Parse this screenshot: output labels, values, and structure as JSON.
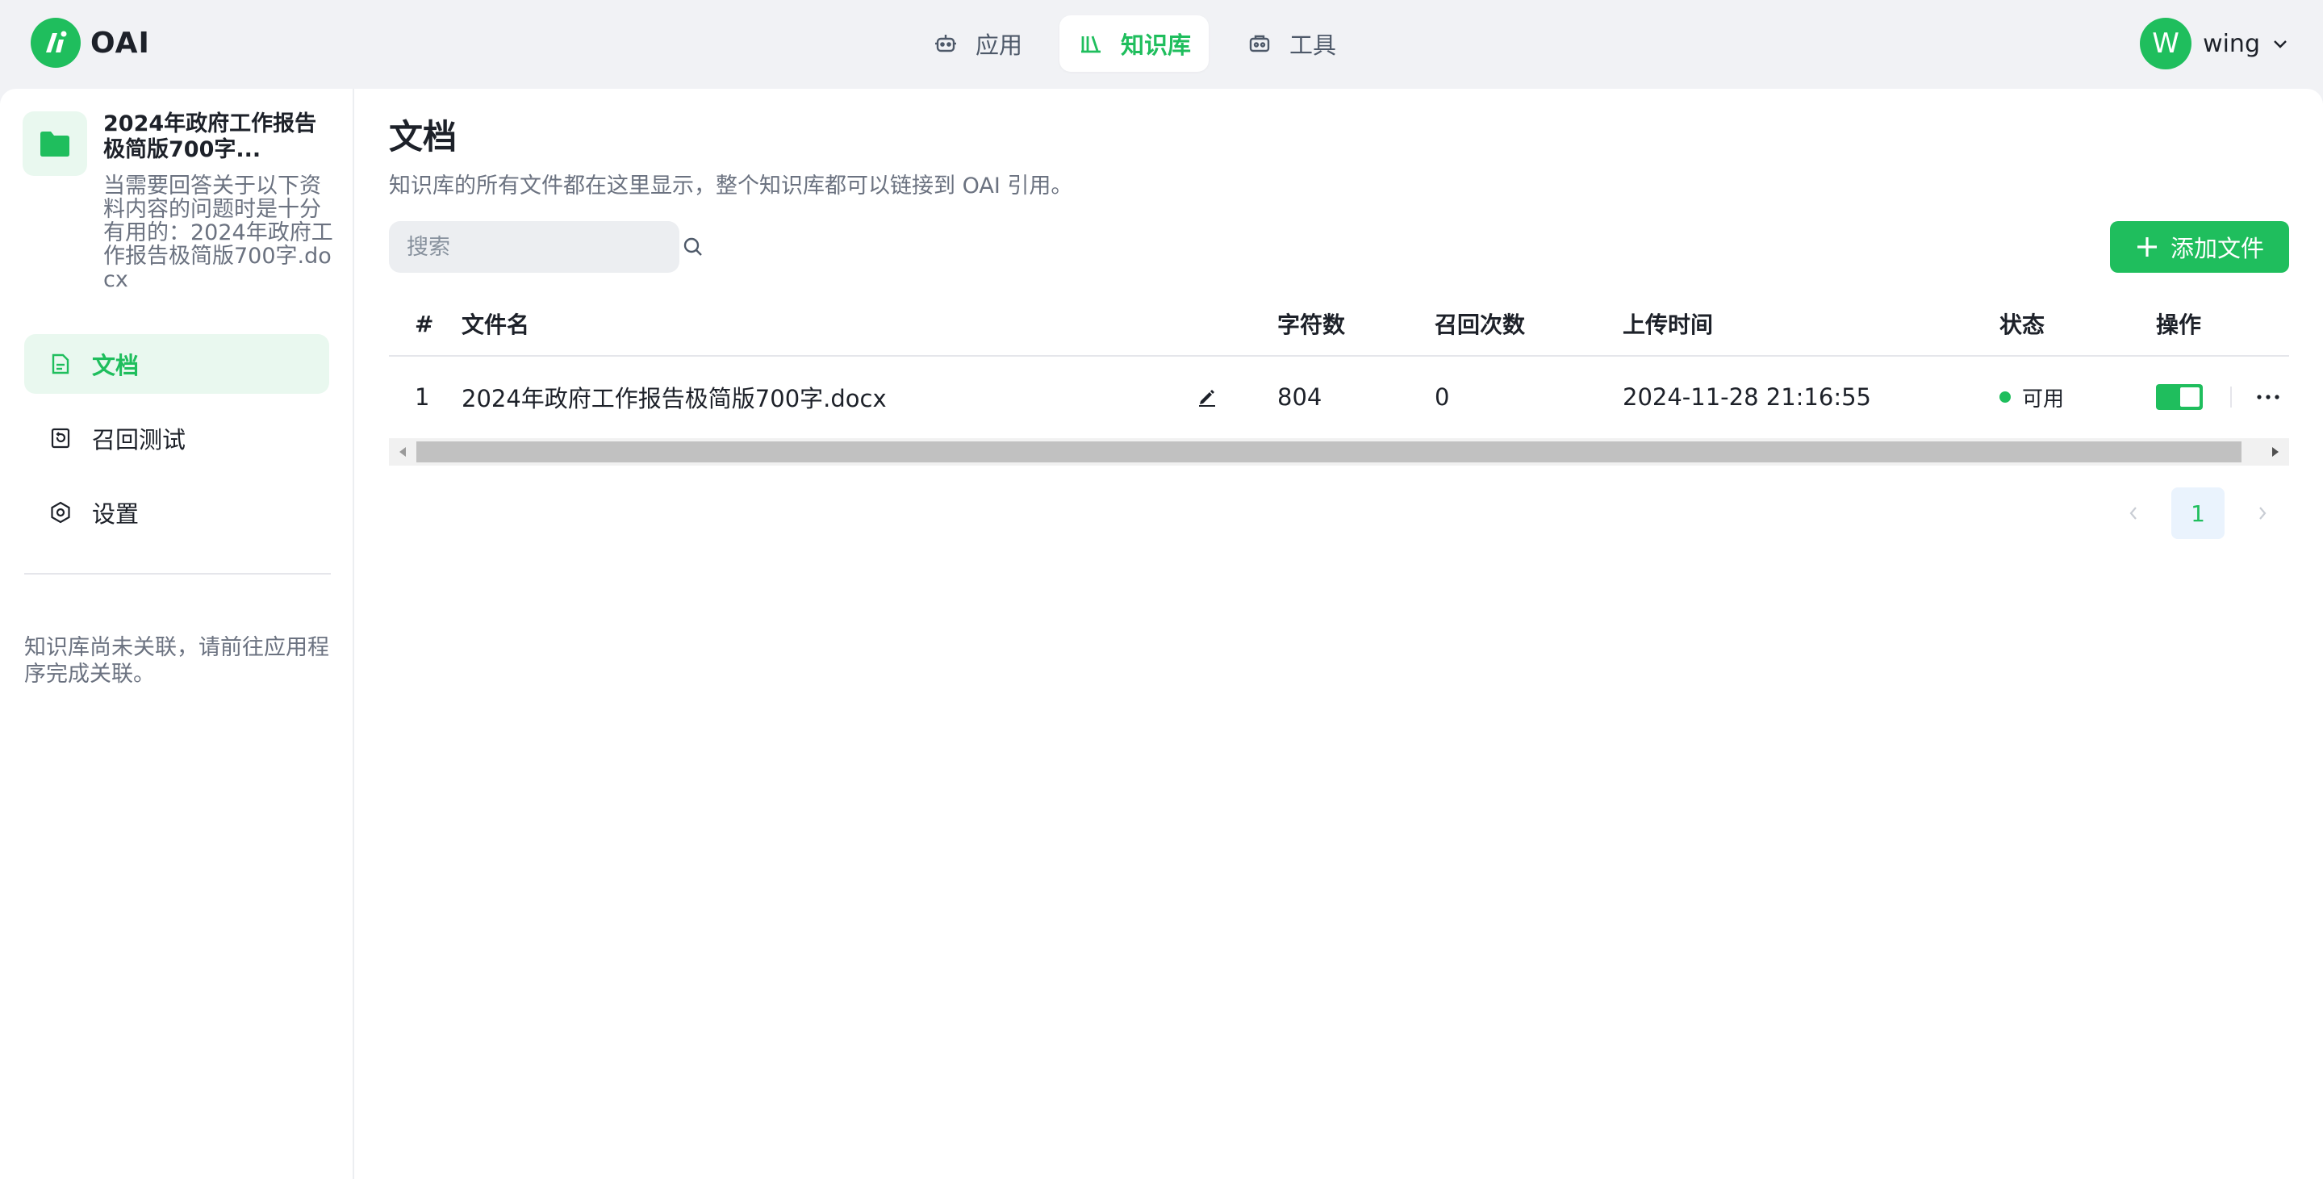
{
  "brand": {
    "name": "OAI",
    "accent": "#1fbe5d"
  },
  "nav": {
    "items": [
      {
        "label": "应用",
        "icon": "robot-icon",
        "active": false
      },
      {
        "label": "知识库",
        "icon": "books-icon",
        "active": true
      },
      {
        "label": "工具",
        "icon": "toolbox-icon",
        "active": false
      }
    ]
  },
  "user": {
    "initial": "W",
    "name": "wing"
  },
  "sidebar": {
    "kb_name": "2024年政府工作报告极简版700字...",
    "kb_desc": "当需要回答关于以下资料内容的问题时是十分有用的：2024年政府工作报告极简版700字.docx",
    "items": [
      {
        "label": "文档",
        "icon": "document-icon",
        "active": true
      },
      {
        "label": "召回测试",
        "icon": "recall-icon",
        "active": false
      },
      {
        "label": "设置",
        "icon": "settings-icon",
        "active": false
      }
    ],
    "note": "知识库尚未关联，请前往应用程序完成关联。"
  },
  "content": {
    "title": "文档",
    "subtitle": "知识库的所有文件都在这里显示，整个知识库都可以链接到 OAI 引用。",
    "search_placeholder": "搜索",
    "add_button": "添加文件"
  },
  "table": {
    "headers": {
      "idx": "#",
      "name": "文件名",
      "chars": "字符数",
      "recall": "召回次数",
      "time": "上传时间",
      "status": "状态",
      "ops": "操作"
    },
    "rows": [
      {
        "idx": "1",
        "name": "2024年政府工作报告极简版700字.docx",
        "chars": "804",
        "recall": "0",
        "time": "2024-11-28 21:16:55",
        "status": "可用",
        "enabled": true
      }
    ]
  },
  "pagination": {
    "current": "1"
  }
}
